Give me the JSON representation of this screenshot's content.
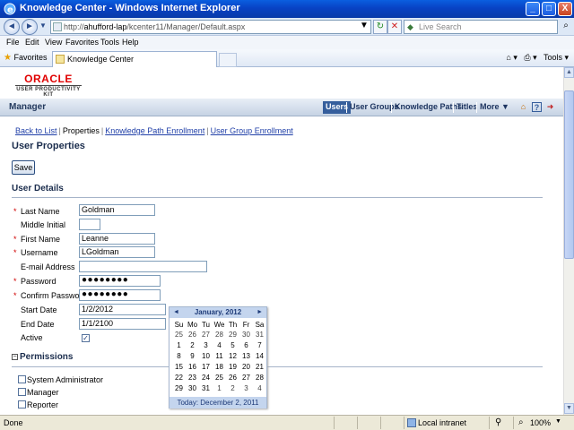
{
  "window": {
    "title": "Knowledge Center - Windows Internet Explorer",
    "minimize": "_",
    "maximize": "□",
    "close": "X"
  },
  "addressbar": {
    "url_prefix": "http://",
    "url_host": "ahufford-lap",
    "url_path": "/kcenter11/Manager/Default.aspx",
    "search_placeholder": "Live Search"
  },
  "menu": [
    "File",
    "Edit",
    "View",
    "Favorites",
    "Tools",
    "Help"
  ],
  "favorites": {
    "favorites_label": "Favorites",
    "tab_title": "Knowledge Center",
    "tools_label": "Tools"
  },
  "header": {
    "logo_brand": "ORACLE",
    "logo_sub": "USER PRODUCTIVITY KIT"
  },
  "managerbar": {
    "title": "Manager",
    "nav": [
      "Users",
      "User Groups",
      "Knowledge Paths",
      "Titles",
      "More ▼"
    ],
    "active": "Users"
  },
  "sublinks": {
    "back": "Back to List",
    "properties": "Properties",
    "kp_enrollment": "Knowledge Path Enrollment",
    "ug_enrollment": "User Group Enrollment"
  },
  "page": {
    "heading": "User Properties",
    "save_label": "Save",
    "details_heading": "User Details",
    "permissions_heading": "Permissions"
  },
  "fields": {
    "last_name": {
      "label": "Last Name",
      "value": "Goldman",
      "required": "*"
    },
    "middle_initial": {
      "label": "Middle Initial",
      "value": ""
    },
    "first_name": {
      "label": "First Name",
      "value": "Leanne",
      "required": "*"
    },
    "username": {
      "label": "Username",
      "value": "LGoldman",
      "required": "*"
    },
    "email": {
      "label": "E-mail Address",
      "value": ""
    },
    "password": {
      "label": "Password",
      "value": "●●●●●●●●",
      "required": "*"
    },
    "confirm_password": {
      "label": "Confirm Password",
      "value": "●●●●●●●●",
      "required": "*"
    },
    "start_date": {
      "label": "Start Date",
      "value": "1/2/2012"
    },
    "end_date": {
      "label": "End Date",
      "value": "1/1/2100"
    },
    "active": {
      "label": "Active",
      "checked": "✓"
    }
  },
  "permissions": [
    "System Administrator",
    "Manager",
    "Reporter"
  ],
  "calendar": {
    "month_label": "January, 2012",
    "prev": "◄",
    "next": "►",
    "dow": [
      "Su",
      "Mo",
      "Tu",
      "We",
      "Th",
      "Fr",
      "Sa"
    ],
    "weeks": [
      [
        "25",
        "26",
        "27",
        "28",
        "29",
        "30",
        "31"
      ],
      [
        "1",
        "2",
        "3",
        "4",
        "5",
        "6",
        "7"
      ],
      [
        "8",
        "9",
        "10",
        "11",
        "12",
        "13",
        "14"
      ],
      [
        "15",
        "16",
        "17",
        "18",
        "19",
        "20",
        "21"
      ],
      [
        "22",
        "23",
        "24",
        "25",
        "26",
        "27",
        "28"
      ],
      [
        "29",
        "30",
        "31",
        "1",
        "2",
        "3",
        "4"
      ]
    ],
    "today_label": "Today: December 2, 2011"
  },
  "status": {
    "text": "Done",
    "zone": "Local intranet",
    "zoom": "100%"
  }
}
